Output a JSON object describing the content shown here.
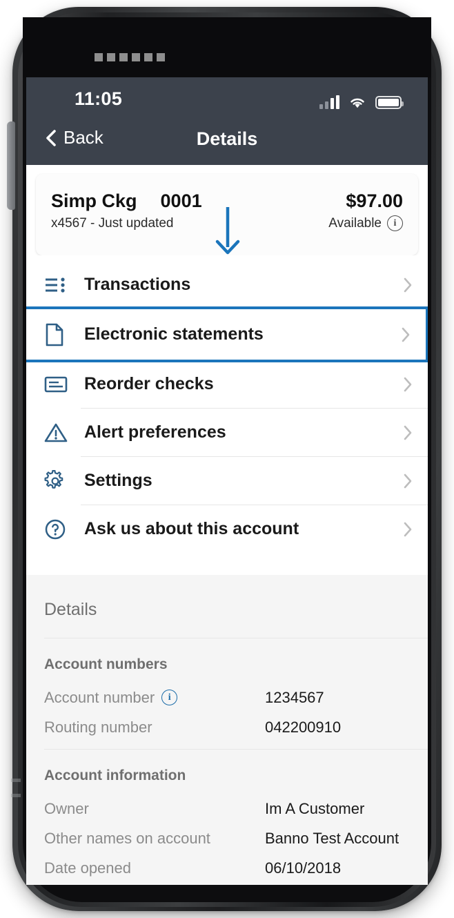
{
  "device": {
    "speaker_dots": 6
  },
  "status_bar": {
    "time": "11:05",
    "signal_icon": "cellular-signal-icon",
    "wifi_icon": "wifi-icon",
    "battery_icon": "battery-full-icon"
  },
  "nav": {
    "back_label": "Back",
    "back_icon": "chevron-left-icon",
    "title": "Details"
  },
  "account_card": {
    "name": "Simp Ckg",
    "number": "0001",
    "balance": "$97.00",
    "subtitle": "x4567  -  Just updated",
    "balance_label": "Available",
    "info_icon": "info-circle-icon"
  },
  "menu": {
    "items": [
      {
        "label": "Transactions",
        "icon": "list-icon",
        "highlighted": false
      },
      {
        "label": "Electronic statements",
        "icon": "document-icon",
        "highlighted": true
      },
      {
        "label": "Reorder checks",
        "icon": "check-card-icon",
        "highlighted": false
      },
      {
        "label": "Alert preferences",
        "icon": "alert-triangle-icon",
        "highlighted": false
      },
      {
        "label": "Settings",
        "icon": "gear-icon",
        "highlighted": false
      },
      {
        "label": "Ask us about this account",
        "icon": "question-circle-icon",
        "highlighted": false
      }
    ],
    "chevron_icon": "chevron-right-icon",
    "annotation_icon": "arrow-down-annotation"
  },
  "details": {
    "title": "Details",
    "groups": [
      {
        "title": "Account numbers",
        "rows": [
          {
            "key": "Account number",
            "value": "1234567",
            "icon": "info-circle-icon"
          },
          {
            "key": "Routing number",
            "value": "042200910",
            "icon": ""
          }
        ]
      },
      {
        "title": "Account information",
        "rows": [
          {
            "key": "Owner",
            "value": "Im A Customer",
            "icon": ""
          },
          {
            "key": "Other names on account",
            "value": "Banno Test Account",
            "icon": ""
          },
          {
            "key": "Date opened",
            "value": "06/10/2018",
            "icon": ""
          }
        ]
      }
    ]
  },
  "colors": {
    "accent_blue": "#1b6ca8",
    "highlight_blue": "#1b75bb",
    "navbar": "#3c424c",
    "details_bg": "#f5f5f5"
  }
}
